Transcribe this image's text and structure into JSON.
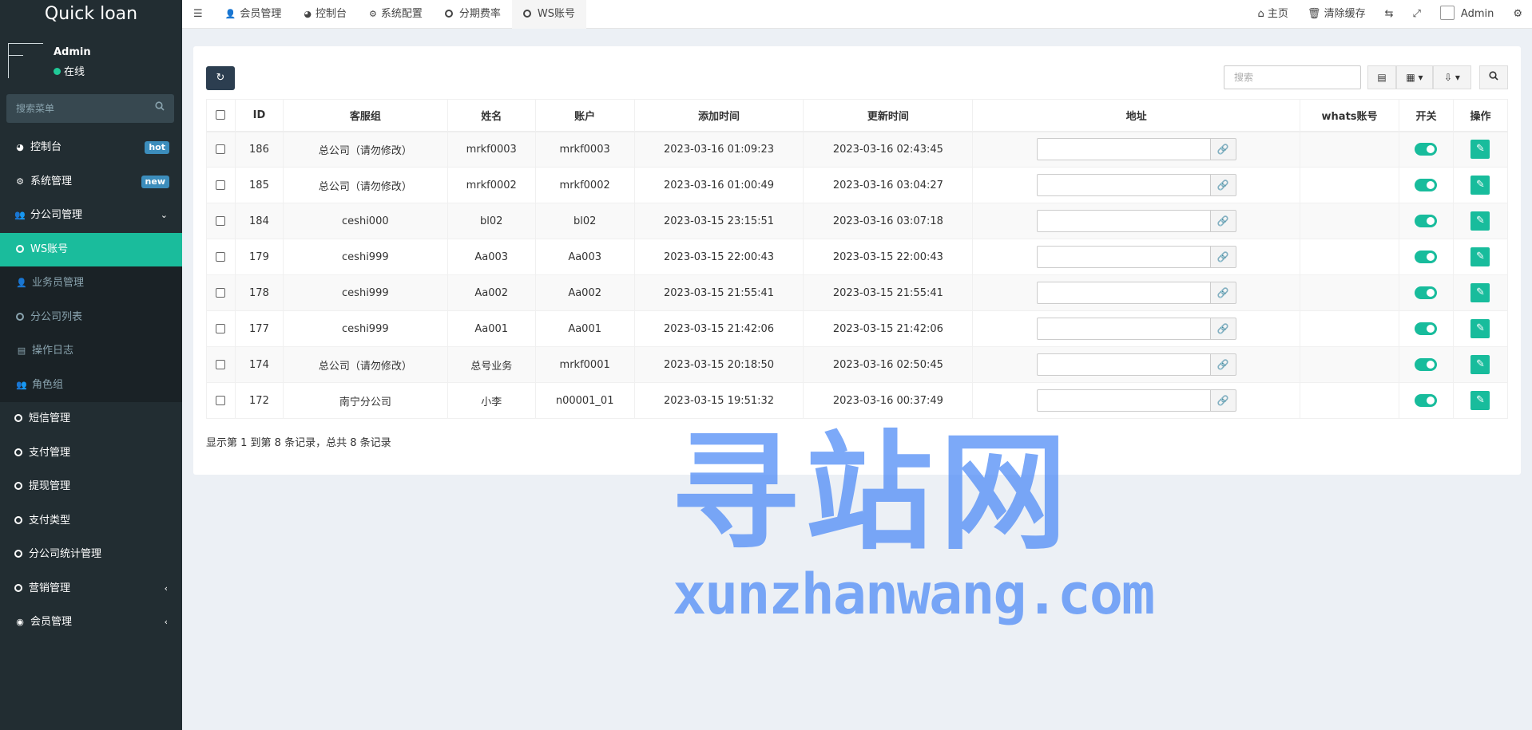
{
  "app": {
    "logo": "Quick loan"
  },
  "user": {
    "name": "Admin",
    "status": "在线"
  },
  "sidebar": {
    "search_placeholder": "搜索菜单",
    "items": [
      {
        "label": "控制台",
        "icon": "dashboard-icon",
        "badge": "hot"
      },
      {
        "label": "系统管理",
        "icon": "cogs-icon",
        "badge": "new"
      },
      {
        "label": "分公司管理",
        "icon": "users-icon",
        "expanded": true
      },
      {
        "label": "WS账号",
        "icon": "circle-icon",
        "active": true
      },
      {
        "label": "业务员管理",
        "icon": "user-icon"
      },
      {
        "label": "分公司列表",
        "icon": "circle-icon"
      },
      {
        "label": "操作日志",
        "icon": "list-icon"
      },
      {
        "label": "角色组",
        "icon": "users-icon"
      },
      {
        "label": "短信管理",
        "icon": "circle-icon"
      },
      {
        "label": "支付管理",
        "icon": "circle-icon"
      },
      {
        "label": "提现管理",
        "icon": "circle-icon"
      },
      {
        "label": "支付类型",
        "icon": "circle-icon"
      },
      {
        "label": "分公司统计管理",
        "icon": "circle-icon"
      },
      {
        "label": "营销管理",
        "icon": "circle-icon"
      },
      {
        "label": "会员管理",
        "icon": "user-circle-icon"
      }
    ]
  },
  "topnav": {
    "tabs": [
      "会员管理",
      "控制台",
      "系统配置",
      "分期费率",
      "WS账号"
    ],
    "home": "主页",
    "clear_cache": "清除缓存",
    "admin": "Admin"
  },
  "toolbar": {
    "search_placeholder": "搜索"
  },
  "table": {
    "headers": [
      "ID",
      "客服组",
      "姓名",
      "账户",
      "添加时间",
      "更新时间",
      "地址",
      "whats账号",
      "开关",
      "操作"
    ],
    "rows": [
      {
        "id": "186",
        "group": "总公司（请勿修改）",
        "name": "mrkf0003",
        "account": "mrkf0003",
        "added": "2023-03-16 01:09:23",
        "updated": "2023-03-16 02:43:45",
        "whats": "",
        "switch": true
      },
      {
        "id": "185",
        "group": "总公司（请勿修改）",
        "name": "mrkf0002",
        "account": "mrkf0002",
        "added": "2023-03-16 01:00:49",
        "updated": "2023-03-16 03:04:27",
        "whats": "",
        "switch": true
      },
      {
        "id": "184",
        "group": "ceshi000",
        "name": "bl02",
        "account": "bl02",
        "added": "2023-03-15 23:15:51",
        "updated": "2023-03-16 03:07:18",
        "whats": "",
        "switch": true
      },
      {
        "id": "179",
        "group": "ceshi999",
        "name": "Aa003",
        "account": "Aa003",
        "added": "2023-03-15 22:00:43",
        "updated": "2023-03-15 22:00:43",
        "whats": "",
        "switch": true
      },
      {
        "id": "178",
        "group": "ceshi999",
        "name": "Aa002",
        "account": "Aa002",
        "added": "2023-03-15 21:55:41",
        "updated": "2023-03-15 21:55:41",
        "whats": "",
        "switch": true
      },
      {
        "id": "177",
        "group": "ceshi999",
        "name": "Aa001",
        "account": "Aa001",
        "added": "2023-03-15 21:42:06",
        "updated": "2023-03-15 21:42:06",
        "whats": "",
        "switch": true
      },
      {
        "id": "174",
        "group": "总公司（请勿修改）",
        "name": "总号业务",
        "account": "mrkf0001",
        "added": "2023-03-15 20:18:50",
        "updated": "2023-03-16 02:50:45",
        "whats": "",
        "switch": true
      },
      {
        "id": "172",
        "group": "南宁分公司",
        "name": "小李",
        "account": "n00001_01",
        "added": "2023-03-15 19:51:32",
        "updated": "2023-03-16 00:37:49",
        "whats": "",
        "switch": true
      }
    ]
  },
  "footer": {
    "info": "显示第 1 到第 8 条记录，总共 8 条记录"
  },
  "watermark": {
    "cn": "寻站网",
    "en": "xunzhanwang.com"
  },
  "colors": {
    "sidebar": "#222d32",
    "accent": "#18bc9c",
    "badge": "#3c8dbc",
    "watermark": "#508cf5"
  }
}
